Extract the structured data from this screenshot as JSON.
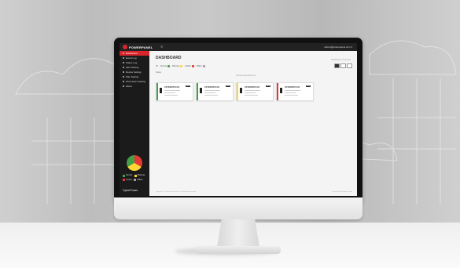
{
  "app": {
    "logo_text": "POWERPANEL",
    "menu_glyph": "≡",
    "user_text": "admin@powerpanel.com ▾"
  },
  "sidebar": {
    "items": [
      {
        "label": "Dashboard",
        "active": true
      },
      {
        "label": "Event Log",
        "active": false
      },
      {
        "label": "Status Log",
        "active": false
      },
      {
        "label": "Alert Setting",
        "active": false
      },
      {
        "label": "Device Setting",
        "active": false
      },
      {
        "label": "Plan Setting",
        "active": false
      },
      {
        "label": "Permission Setting",
        "active": false
      },
      {
        "label": "About",
        "active": false
      }
    ],
    "status_chart": {
      "type": "pie",
      "colors": [
        "#e53935",
        "#fdd835",
        "#43a047"
      ]
    },
    "legend": [
      "Normal",
      "Warning",
      "Critical",
      "Offline"
    ],
    "brand": "CyberPower"
  },
  "main": {
    "title": "DASHBOARD",
    "breadcrumb": "Dashboard / Overview",
    "filter_all": "All",
    "filters": [
      {
        "label": "Normal",
        "color": "#43a047"
      },
      {
        "label": "Warning",
        "color": "#fdd835"
      },
      {
        "label": "Critical",
        "color": "#e53935"
      },
      {
        "label": "Offline",
        "color": "#9e9e9e"
      }
    ],
    "group_label": "Group",
    "center_label": "All Connected Devices",
    "devices": [
      {
        "name": "CP1500PFCLCD",
        "badge": "UPS",
        "status_color": "#43a047"
      },
      {
        "name": "CP1500PFCLCD",
        "badge": "UPS",
        "status_color": "#43a047"
      },
      {
        "name": "CP1500PFCLCD",
        "badge": "UPS",
        "status_color": "#fdd835"
      },
      {
        "name": "CP1500PFCLCD",
        "badge": "UPS",
        "status_color": "#e53935"
      }
    ],
    "footer_left": "Copyright © CyberPower Systems, Inc. All rights reserved.",
    "footer_right": "PowerPanel Business Cloud"
  }
}
